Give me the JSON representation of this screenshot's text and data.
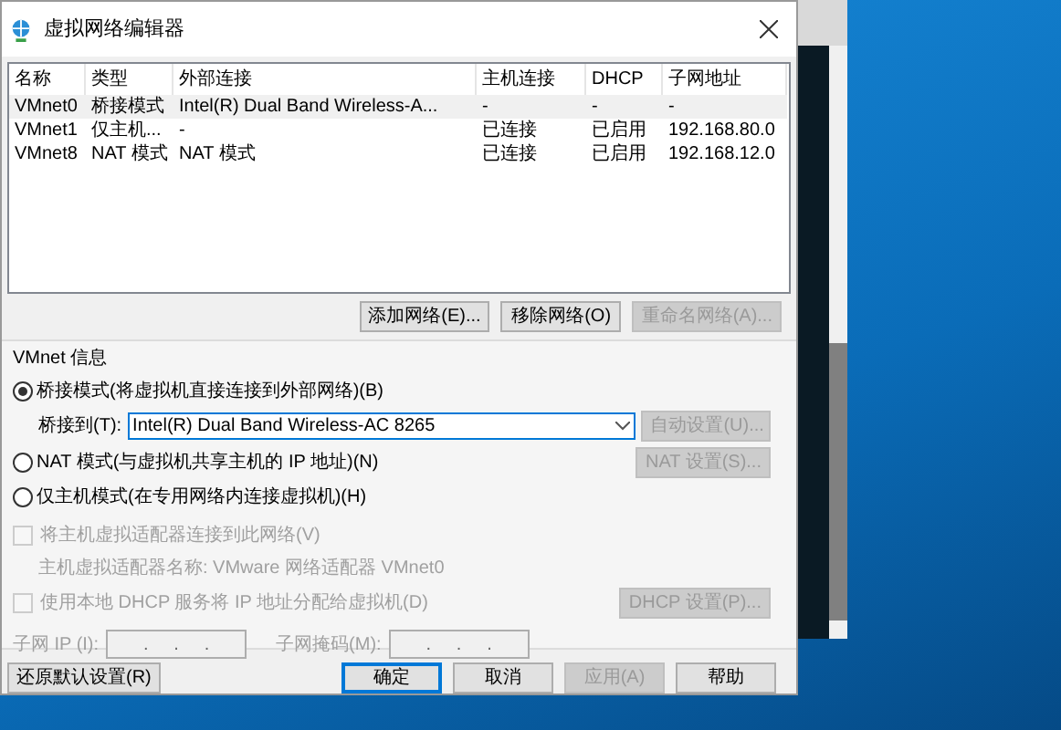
{
  "window": {
    "title": "虚拟网络编辑器"
  },
  "table": {
    "columns": [
      "名称",
      "类型",
      "外部连接",
      "主机连接",
      "DHCP",
      "子网地址"
    ],
    "rows": [
      {
        "cells": [
          "VMnet0",
          "桥接模式",
          "Intel(R) Dual Band Wireless-A...",
          "-",
          "-",
          "-"
        ],
        "selected": true
      },
      {
        "cells": [
          "VMnet1",
          "仅主机...",
          "-",
          "已连接",
          "已启用",
          "192.168.80.0"
        ],
        "selected": false
      },
      {
        "cells": [
          "VMnet8",
          "NAT 模式",
          "NAT 模式",
          "已连接",
          "已启用",
          "192.168.12.0"
        ],
        "selected": false
      }
    ]
  },
  "list_buttons": [
    {
      "label": "添加网络(E)...",
      "disabled": false
    },
    {
      "label": "移除网络(O)",
      "disabled": false
    },
    {
      "label": "重命名网络(A)...",
      "disabled": true
    }
  ],
  "vmnet_info": {
    "title": "VMnet 信息",
    "modes": [
      {
        "label": "桥接模式(将虚拟机直接连接到外部网络)(B)",
        "selected": true
      },
      {
        "label": "NAT 模式(与虚拟机共享主机的 IP 地址)(N)",
        "selected": false
      },
      {
        "label": "仅主机模式(在专用网络内连接虚拟机)(H)",
        "selected": false
      }
    ],
    "bridge_label": "桥接到(T):",
    "bridge_value": "Intel(R) Dual Band Wireless-AC 8265",
    "auto_button": {
      "label": "自动设置(U)...",
      "disabled": true
    },
    "nat_button": {
      "label": "NAT 设置(S)...",
      "disabled": true
    },
    "host_adapter": {
      "label": "将主机虚拟适配器连接到此网络(V)",
      "checked": false,
      "disabled": true
    },
    "adapter_note": "主机虚拟适配器名称: VMware 网络适配器 VMnet0",
    "dhcp": {
      "label": "使用本地 DHCP 服务将 IP 地址分配给虚拟机(D)",
      "checked": false,
      "disabled": true
    },
    "dhcp_button": {
      "label": "DHCP 设置(P)...",
      "disabled": true
    },
    "subnet_ip": {
      "label": "子网 IP (I):",
      "value": ".     .     ."
    },
    "subnet_mask": {
      "label": "子网掩码(M):",
      "value": ".     .     ."
    }
  },
  "footer": {
    "restore": {
      "label": "还原默认设置(R)",
      "disabled": false
    },
    "buttons": [
      {
        "label": "确定",
        "disabled": false,
        "default": true
      },
      {
        "label": "取消",
        "disabled": false,
        "default": false
      },
      {
        "label": "应用(A)",
        "disabled": true,
        "default": false
      },
      {
        "label": "帮助",
        "disabled": false,
        "default": false
      }
    ]
  }
}
